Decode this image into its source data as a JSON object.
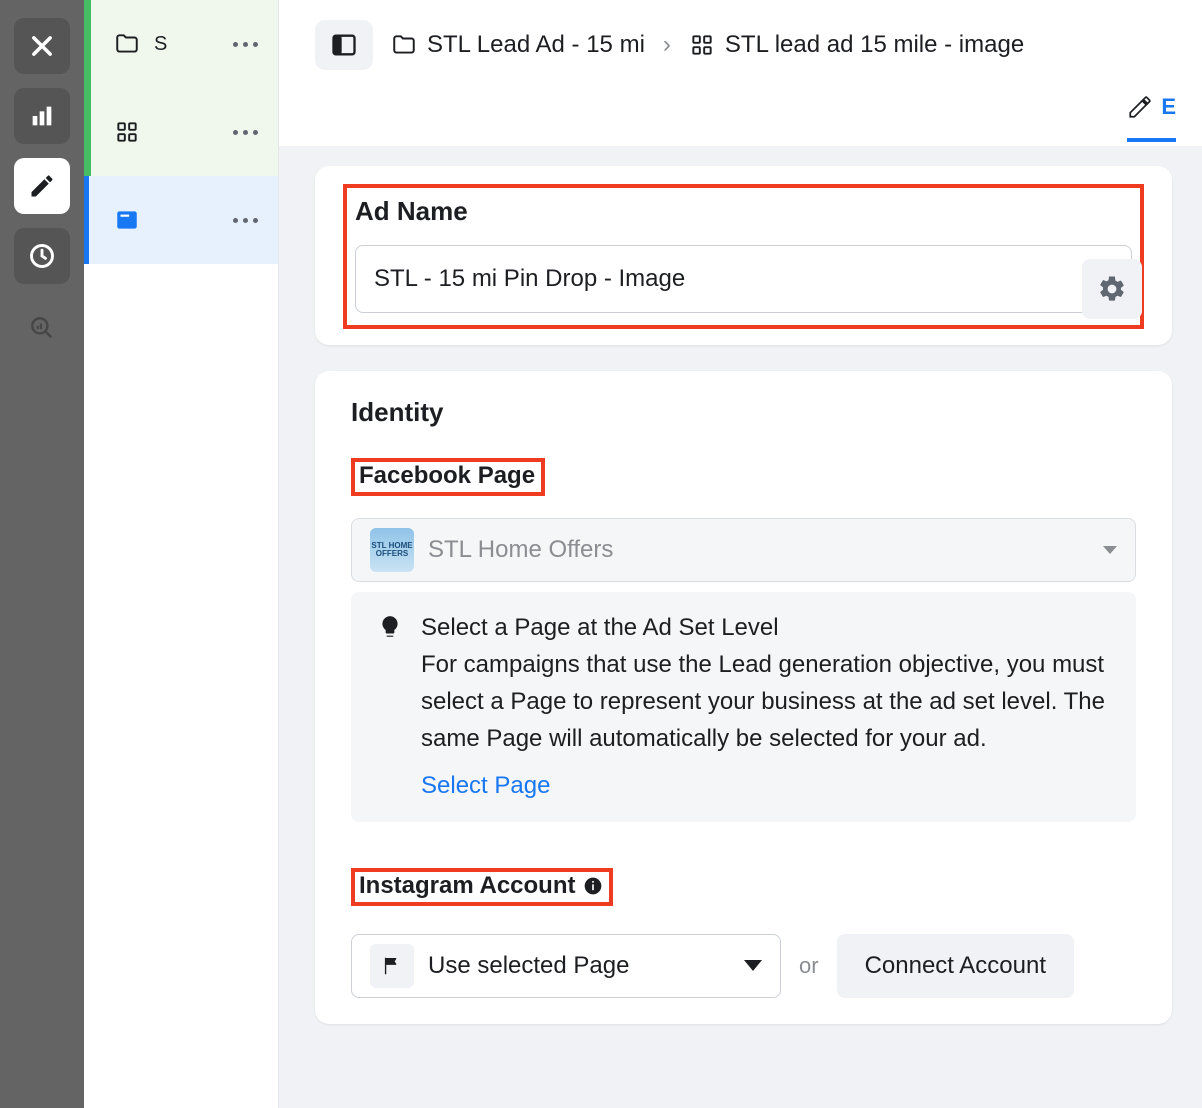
{
  "rail": {
    "close": "Close",
    "charts": "Charts",
    "edit": "Edit",
    "history": "History",
    "inspect": "Inspect"
  },
  "tree": {
    "campaign_trunc": "S",
    "adset_trunc": "",
    "ad_trunc": ""
  },
  "breadcrumb": {
    "campaign": "STL Lead Ad - 15 mi",
    "adset": "STL lead ad 15 mile - image"
  },
  "edit_tab_label": "E",
  "ad_name": {
    "section_label": "Ad Name",
    "value": "STL - 15 mi Pin Drop - Image"
  },
  "identity": {
    "section_label": "Identity",
    "fb_label": "Facebook Page",
    "fb_page_name": "STL Home Offers",
    "tip_title": "Select a Page at the Ad Set Level",
    "tip_body": "For campaigns that use the Lead generation objective, you must select a Page to represent your business at the ad set level. The same Page will automatically be selected for your ad.",
    "tip_link": "Select Page",
    "ig_label": "Instagram Account",
    "ig_value": "Use selected Page",
    "or": "or",
    "connect": "Connect Account"
  }
}
